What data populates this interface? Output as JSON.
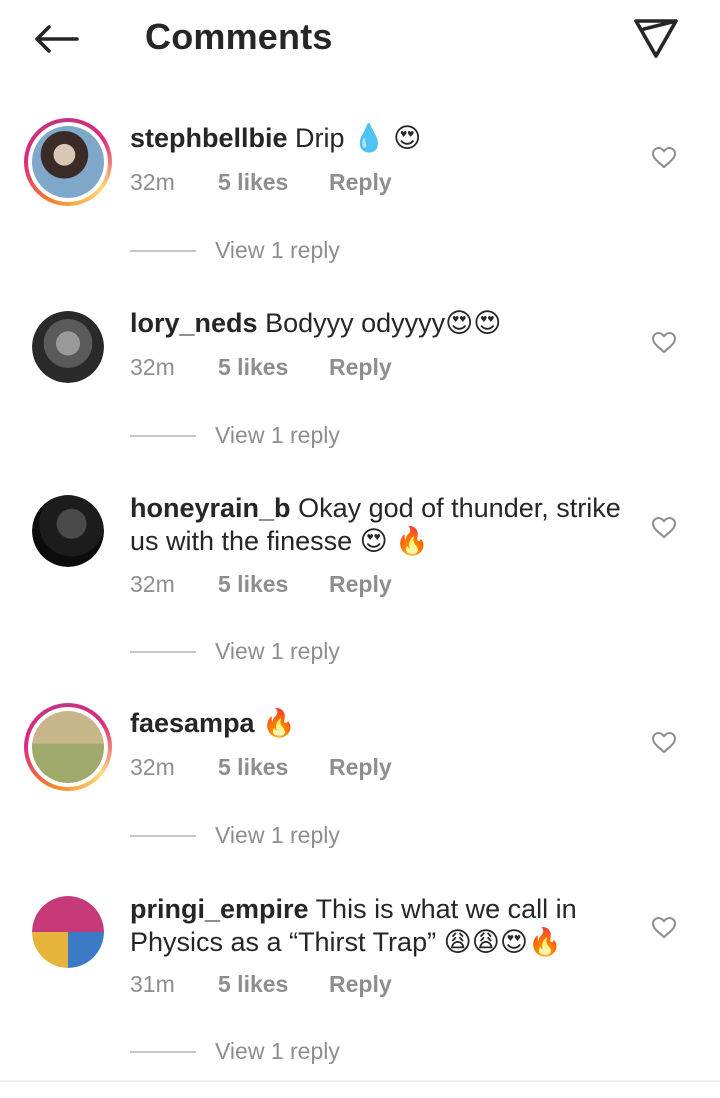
{
  "header": {
    "title": "Comments"
  },
  "comments": [
    {
      "username": "stephbellbie",
      "text": "Drip 💧 😍",
      "time": "32m",
      "likes": "5 likes",
      "reply": "Reply",
      "view_replies": "View 1 reply",
      "story_ring": true,
      "avatar_colors": [
        "#7fa7c9",
        "#d8c7b5",
        "#3b2b26"
      ]
    },
    {
      "username": "lory_neds",
      "text": "Bodyyy odyyyy😍😍",
      "time": "32m",
      "likes": "5 likes",
      "reply": "Reply",
      "view_replies": "View 1 reply",
      "story_ring": false,
      "avatar_colors": [
        "#9a9a9a",
        "#5a5a5a",
        "#2a2a2a"
      ]
    },
    {
      "username": "honeyrain_b",
      "text": "Okay god of thunder, strike us with the finesse 😍 🔥",
      "time": "32m",
      "likes": "5 likes",
      "reply": "Reply",
      "view_replies": "View 1 reply",
      "story_ring": false,
      "avatar_colors": [
        "#1c1c1c",
        "#4a4a4a",
        "#0c0c0c"
      ]
    },
    {
      "username": "faesampa",
      "text": "🔥",
      "time": "32m",
      "likes": "5 likes",
      "reply": "Reply",
      "view_replies": "View 1 reply",
      "story_ring": true,
      "avatar_colors": [
        "#9fa96b",
        "#c9b58a",
        "#5a4a3a"
      ]
    },
    {
      "username": "pringi_empire",
      "text": "This is what we call in Physics as a “Thirst Trap” 😩😩😍🔥",
      "time": "31m",
      "likes": "5 likes",
      "reply": "Reply",
      "view_replies": "View 1 reply",
      "story_ring": false,
      "avatar_colors": [
        "#c63a7a",
        "#3a7ac6",
        "#e6b43a"
      ]
    }
  ],
  "colors": {
    "text": "#262626",
    "secondary": "#8e8e8e",
    "divider": "#c7c7c7"
  },
  "icons": {
    "back": "arrow-left-icon",
    "send": "paper-plane-icon",
    "like": "heart-outline-icon"
  }
}
